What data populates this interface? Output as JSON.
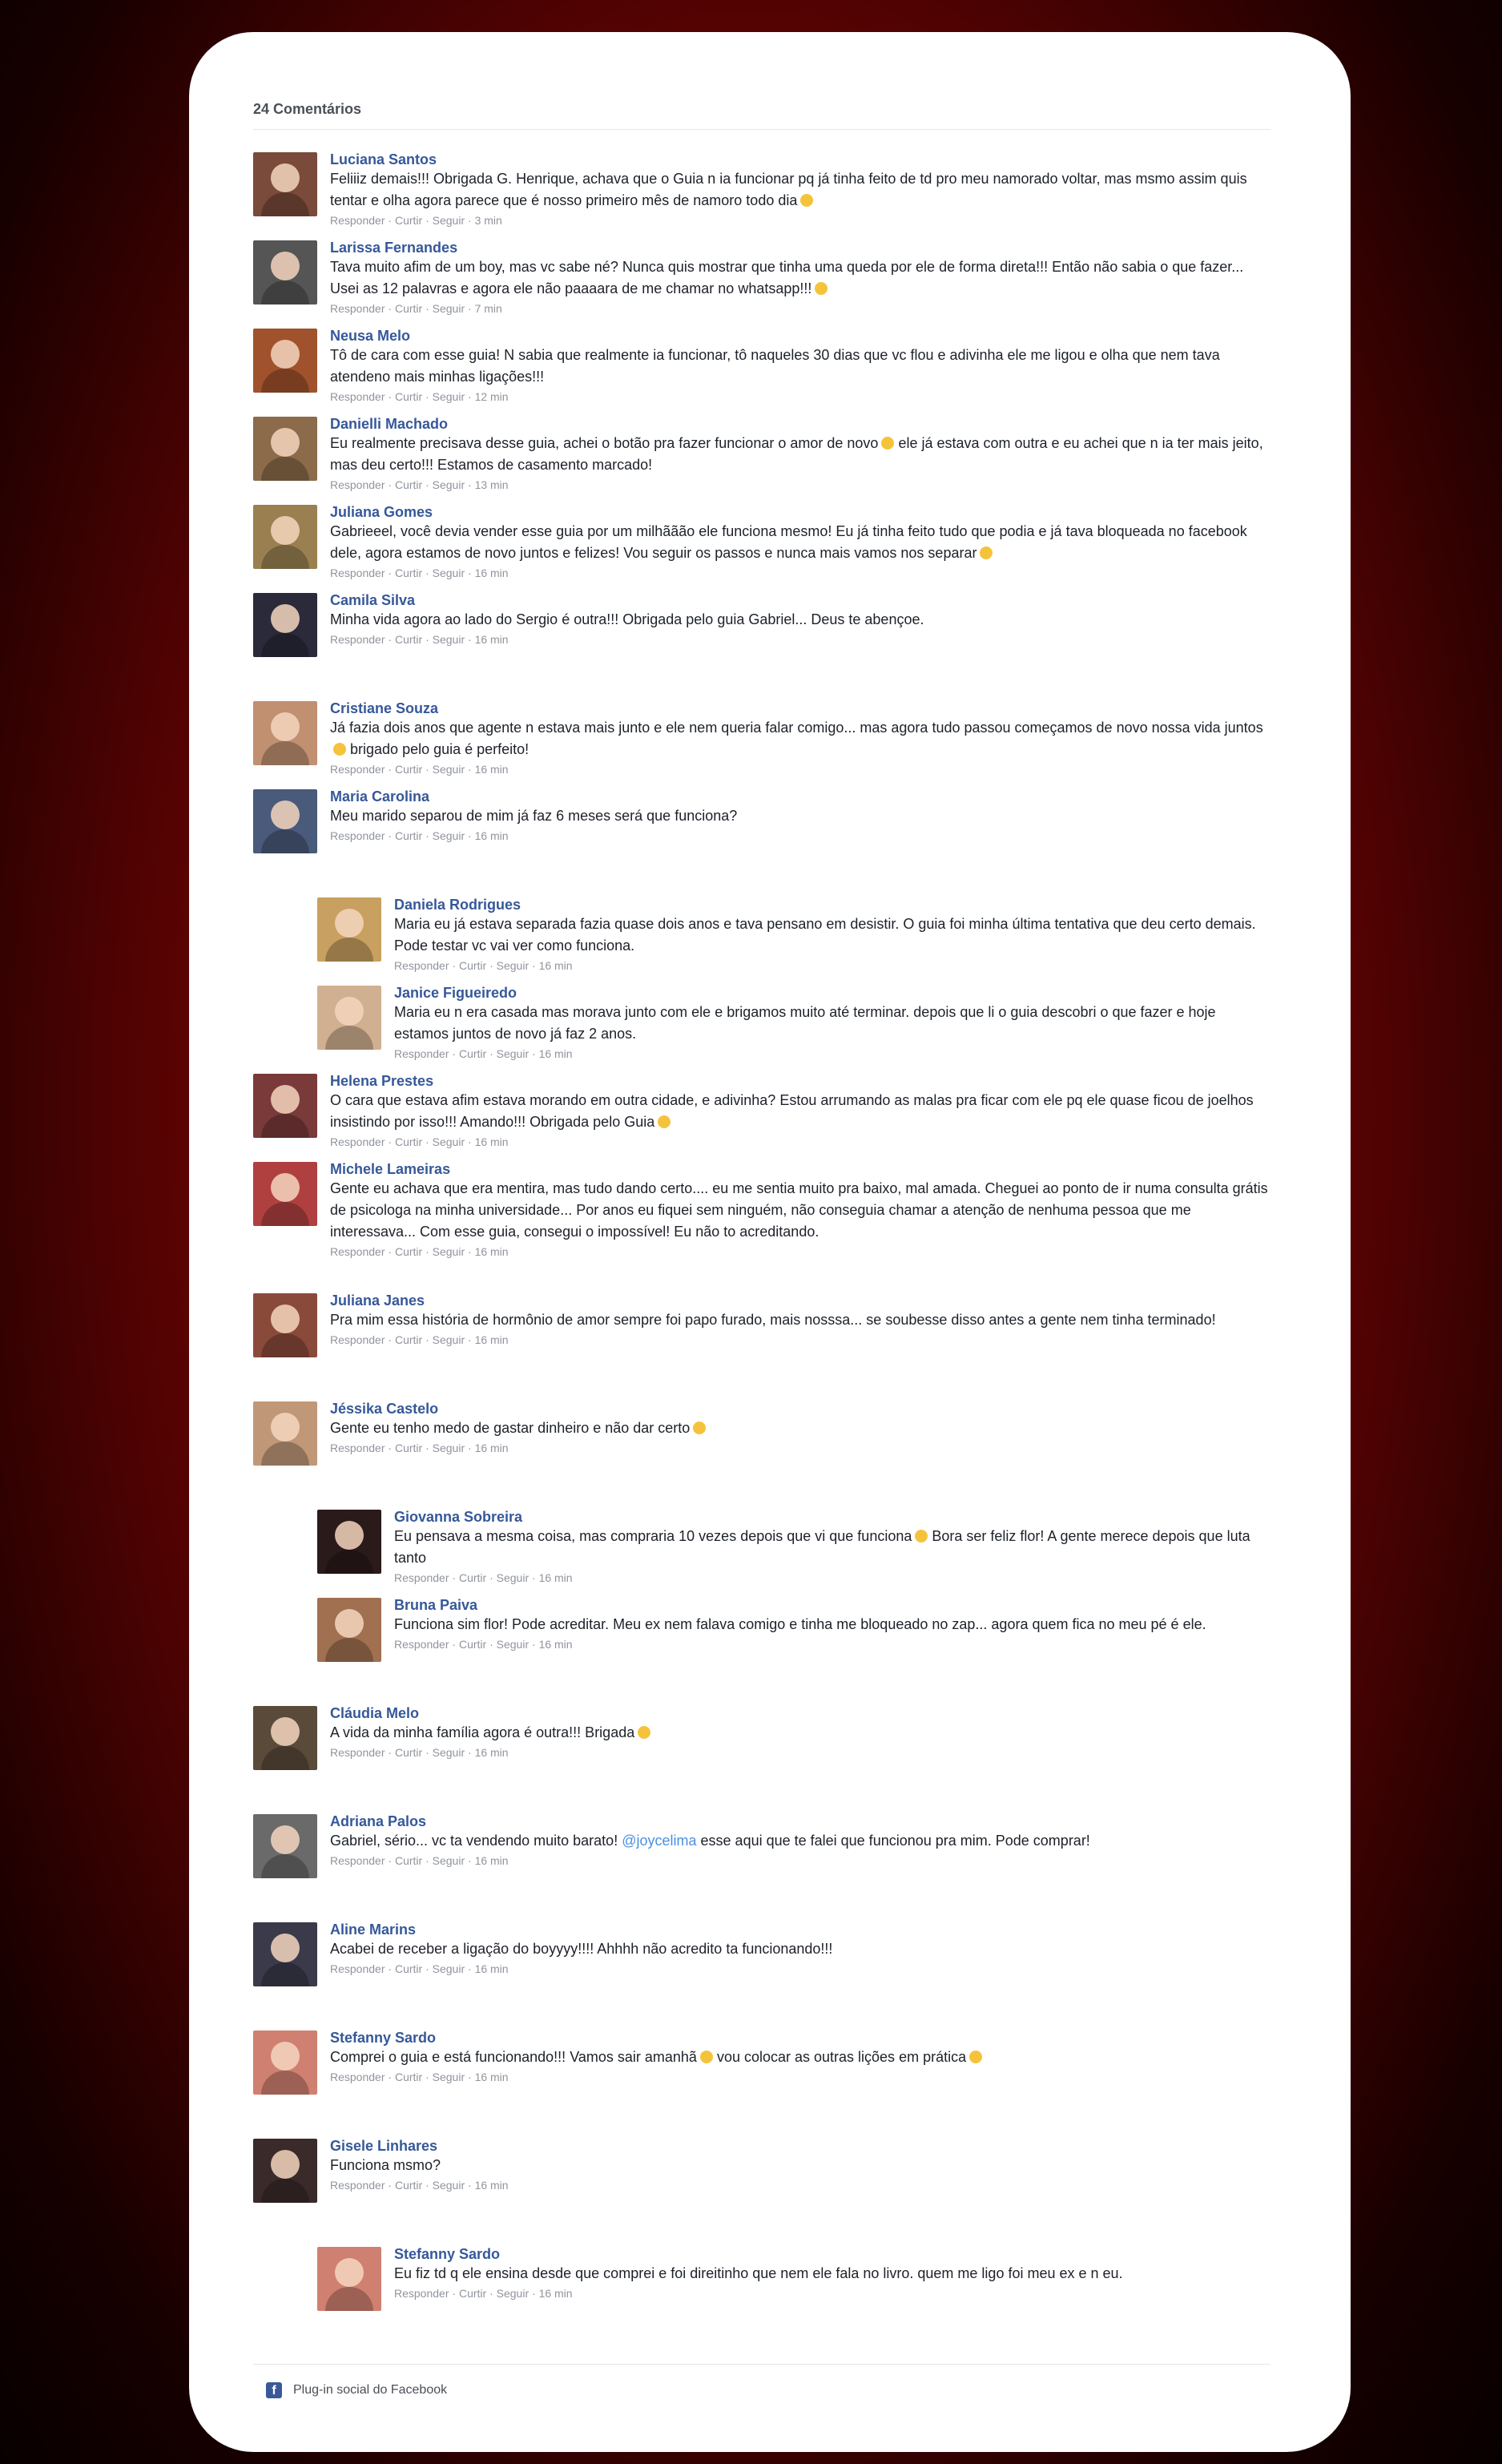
{
  "header": {
    "comment_count": "24 Comentários"
  },
  "actions": {
    "reply": "Responder",
    "like": "Curtir",
    "follow": "Seguir",
    "sep": " · "
  },
  "colors": {
    "accent": "#365899",
    "meta": "#90949c"
  },
  "comments": [
    {
      "name": "Luciana Santos",
      "text": "Feliiiz demais!!! Obrigada G. Henrique, achava que o Guia n ia funcionar pq já tinha feito de td pro meu namorado voltar, mas msmo assim quis tentar e olha agora parece que é nosso primeiro mês de namoro todo dia",
      "time": "3 min",
      "emoji": "heart-eyes-emoji",
      "color": "#7a4a3a"
    },
    {
      "name": "Larissa Fernandes",
      "text": "Tava muito afim de um boy, mas vc sabe né? Nunca quis mostrar que tinha uma queda por ele de forma direta!!! Então não sabia o que fazer... Usei as 12 palavras e agora ele não paaaara de me chamar no whatsapp!!!",
      "time": "7 min",
      "emoji": "smile-emoji",
      "color": "#555555"
    },
    {
      "name": "Neusa Melo",
      "text": "Tô de cara com esse guia! N sabia que realmente ia funcionar, tô naqueles 30 dias que vc flou e adivinha ele me ligou e olha que nem tava atendeno mais minhas ligações!!!",
      "time": "12 min",
      "color": "#a0522d"
    },
    {
      "name": "Danielli Machado",
      "text": "Eu realmente precisava desse guia, achei o botão pra fazer funcionar o amor de novo",
      "text2": "ele já estava com outra e eu achei que n ia ter mais jeito, mas deu certo!!! Estamos de casamento marcado!",
      "time": "13 min",
      "emoji": "smile-emoji",
      "color": "#8b6b4a"
    },
    {
      "name": "Juliana Gomes",
      "text": "Gabrieeel, você devia vender esse guia por um milhããão ele funciona mesmo! Eu já tinha feito tudo que podia e já tava bloqueada no facebook dele, agora estamos de novo juntos e felizes! Vou seguir os passos e nunca mais vamos nos separar",
      "time": "16 min",
      "emoji": "smile-emoji",
      "color": "#9a8050"
    },
    {
      "name": "Camila Silva",
      "text": "Minha vida agora ao lado do Sergio é outra!!! Obrigada pelo guia Gabriel... Deus te abençoe.",
      "time": "16 min",
      "color": "#2a2a3a"
    },
    {
      "name": "Cristiane Souza",
      "text": "Já fazia dois anos que agente n estava mais junto e ele nem queria falar comigo... mas agora tudo passou começamos de novo nossa vida juntos",
      "text2": "brigado pelo guia é perfeito!",
      "time": "16 min",
      "emoji": "smile-emoji",
      "color": "#c09070"
    },
    {
      "name": "Maria Carolina",
      "text": "Meu marido separou de mim já faz 6 meses será que funciona?",
      "time": "16 min",
      "color": "#4a5a7a"
    },
    {
      "name": "Daniela Rodrigues",
      "reply": true,
      "text": "Maria eu já estava separada fazia quase dois anos e tava pensano em desistir. O guia foi minha última tentativa que deu certo demais. Pode testar vc vai ver como funciona.",
      "time": "16 min",
      "color": "#c8a060"
    },
    {
      "name": "Janice Figueiredo",
      "reply": true,
      "text": "Maria eu n era casada mas morava junto com ele e brigamos muito até terminar. depois que li o guia descobri o que fazer e hoje estamos juntos de novo já faz 2 anos.",
      "time": "16 min",
      "color": "#d0b090"
    },
    {
      "name": "Helena Prestes",
      "text": "O cara que estava afim estava morando em outra cidade, e adivinha? Estou arrumando as malas pra ficar com ele pq ele quase ficou de joelhos insistindo por isso!!! Amando!!! Obrigada pelo Guia",
      "time": "16 min",
      "emoji": "smile-emoji",
      "color": "#7a3a3a"
    },
    {
      "name": "Michele Lameiras",
      "text": "Gente eu achava que era mentira, mas tudo dando certo.... eu me sentia muito pra baixo, mal amada. Cheguei ao ponto de ir numa consulta grátis de psicologa na minha universidade... Por anos eu fiquei sem ninguém, não conseguia chamar a atenção de nenhuma pessoa que me interessava... Com esse guia, consegui o impossível! Eu não to acreditando.",
      "time": "16 min",
      "color": "#b04040"
    },
    {
      "name": "Juliana Janes",
      "text": "Pra mim essa história de hormônio de amor sempre foi papo furado, mais nosssa... se soubesse disso antes a gente nem tinha terminado!",
      "time": "16 min",
      "color": "#8a4a3a"
    },
    {
      "name": "Jéssika Castelo",
      "text": "Gente eu tenho medo de gastar dinheiro e não dar certo",
      "time": "16 min",
      "emoji": "worried-emoji",
      "color": "#c09878"
    },
    {
      "name": "Giovanna Sobreira",
      "reply": true,
      "text": "Eu pensava a mesma coisa, mas compraria 10 vezes depois que vi que funciona",
      "text2": "Bora ser feliz flor! A gente merece depois que luta tanto",
      "time": "16 min",
      "emoji": "smile-emoji",
      "color": "#2a1a1a"
    },
    {
      "name": "Bruna Paiva",
      "reply": true,
      "text": "Funciona sim flor! Pode acreditar. Meu ex nem falava comigo e tinha me bloqueado no zap... agora quem fica no meu pé é ele.",
      "time": "16 min",
      "color": "#a07050"
    },
    {
      "name": "Cláudia Melo",
      "text": "A vida da minha família agora é outra!!! Brigada",
      "time": "16 min",
      "emoji": "smile-emoji",
      "color": "#5a4a3a"
    },
    {
      "name": "Adriana Palos",
      "text": "Gabriel, sério... vc ta vendendo muito barato!",
      "mention": "@joycelima",
      "text2": "esse aqui que te falei que funcionou pra mim. Pode comprar!",
      "time": "16 min",
      "color": "#6a6a6a"
    },
    {
      "name": "Aline Marins",
      "text": "Acabei de receber a ligação do boyyyy!!!! Ahhhh não acredito ta funcionando!!!",
      "time": "16 min",
      "color": "#3a3a4a"
    },
    {
      "name": "Stefanny Sardo",
      "text": "Comprei o guia e está funcionando!!! Vamos sair amanhã",
      "text2": "vou colocar as outras lições em prática",
      "time": "16 min",
      "emoji": "wink-emoji",
      "emoji2": "smile-emoji",
      "color": "#d08070"
    },
    {
      "name": "Gisele Linhares",
      "text": "Funciona msmo?",
      "time": "16 min",
      "color": "#3a2a2a"
    },
    {
      "name": "Stefanny Sardo",
      "reply": true,
      "text": "Eu fiz td q ele ensina desde que comprei e foi direitinho que nem ele fala no livro. quem me ligo foi meu ex e n eu.",
      "time": "16 min",
      "color": "#d08070"
    }
  ],
  "footer": {
    "label": "Plug-in social do Facebook",
    "icon": "facebook-icon"
  }
}
